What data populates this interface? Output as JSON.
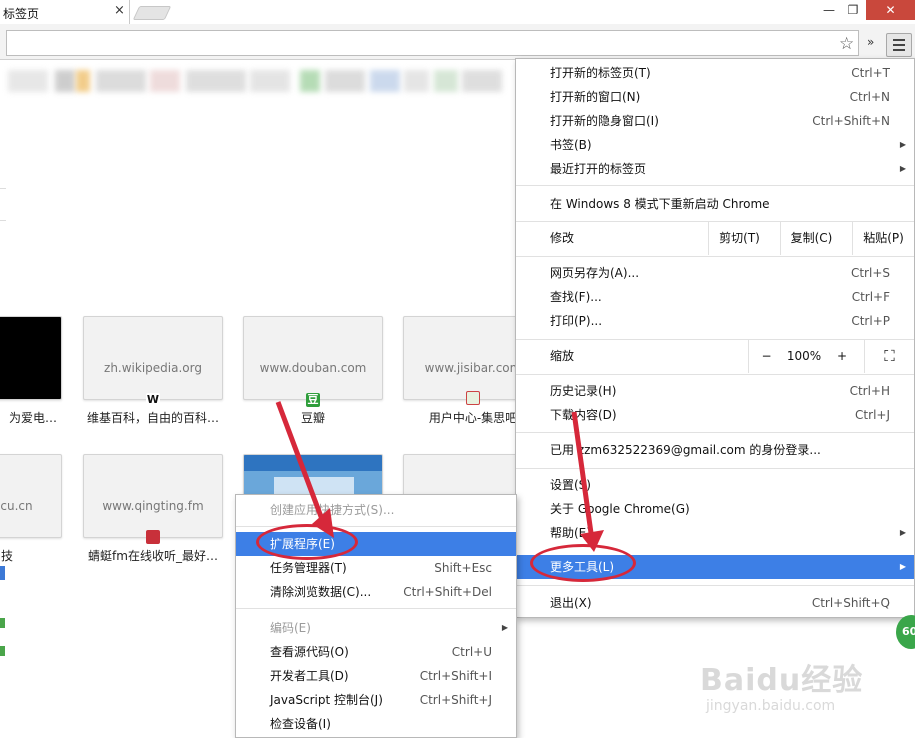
{
  "tab": {
    "title": "标签页",
    "close": "×"
  },
  "window_buttons": {
    "minimize": "—",
    "maximize": "❐",
    "close": "✕"
  },
  "toolbar": {
    "extension_more": "»",
    "star": "☆"
  },
  "thumbnails": [
    {
      "url": "",
      "title": "为爱电…",
      "favicon": ""
    },
    {
      "url": "zh.wikipedia.org",
      "title": "维基百科，自由的百科…",
      "favicon": "W"
    },
    {
      "url": "www.douban.com",
      "title": "豆瓣",
      "favicon": "豆"
    },
    {
      "url": "www.jisibar.com",
      "title": "用户中心-集思吧",
      "favicon": ""
    },
    {
      "url": "ecu.cn",
      "title": "技",
      "favicon": ""
    },
    {
      "url": "www.qingting.fm",
      "title": "蜻蜓fm在线收听_最好…",
      "favicon": ""
    },
    {
      "url": "",
      "title": "",
      "favicon": ""
    },
    {
      "url": "",
      "title": "",
      "favicon": ""
    }
  ],
  "chrome_menu": {
    "new_tab": {
      "label": "打开新的标签页(T)",
      "shortcut": "Ctrl+T"
    },
    "new_window": {
      "label": "打开新的窗口(N)",
      "shortcut": "Ctrl+N"
    },
    "incognito": {
      "label": "打开新的隐身窗口(I)",
      "shortcut": "Ctrl+Shift+N"
    },
    "bookmarks": {
      "label": "书签(B)"
    },
    "recent_tabs": {
      "label": "最近打开的标签页"
    },
    "relaunch": {
      "label": "在 Windows 8 模式下重新启动 Chrome"
    },
    "edit": {
      "label": "修改",
      "cut": "剪切(T)",
      "copy": "复制(C)",
      "paste": "粘贴(P)"
    },
    "save_as": {
      "label": "网页另存为(A)...",
      "shortcut": "Ctrl+S"
    },
    "find": {
      "label": "查找(F)...",
      "shortcut": "Ctrl+F"
    },
    "print": {
      "label": "打印(P)...",
      "shortcut": "Ctrl+P"
    },
    "zoom": {
      "label": "缩放",
      "minus": "−",
      "value": "100%",
      "plus": "+",
      "fullscreen": "⛶"
    },
    "history": {
      "label": "历史记录(H)",
      "shortcut": "Ctrl+H"
    },
    "downloads": {
      "label": "下载内容(D)",
      "shortcut": "Ctrl+J"
    },
    "signed_in": {
      "label": "已用 zzm632522369@gmail.com 的身份登录..."
    },
    "settings": {
      "label": "设置(S)"
    },
    "about": {
      "label": "关于 Google Chrome(G)"
    },
    "help": {
      "label": "帮助(E)"
    },
    "more_tools": {
      "label": "更多工具(L)"
    },
    "exit": {
      "label": "退出(X)",
      "shortcut": "Ctrl+Shift+Q"
    }
  },
  "submenu": {
    "create_shortcut": {
      "label": "创建应用快捷方式(S)..."
    },
    "extensions": {
      "label": "扩展程序(E)"
    },
    "task_manager": {
      "label": "任务管理器(T)",
      "shortcut": "Shift+Esc"
    },
    "clear_data": {
      "label": "清除浏览数据(C)...",
      "shortcut": "Ctrl+Shift+Del"
    },
    "encoding": {
      "label": "编码(E)"
    },
    "view_source": {
      "label": "查看源代码(O)",
      "shortcut": "Ctrl+U"
    },
    "dev_tools": {
      "label": "开发者工具(D)",
      "shortcut": "Ctrl+Shift+I"
    },
    "js_console": {
      "label": "JavaScript 控制台(J)",
      "shortcut": "Ctrl+Shift+J"
    },
    "inspect_devices": {
      "label": "检查设备(I)"
    }
  },
  "badge": "60",
  "watermark": {
    "brand": "Baidu经验",
    "url": "jingyan.baidu.com"
  },
  "colors": {
    "highlight": "#3d7fe6",
    "annotation_red": "#d6283a"
  }
}
